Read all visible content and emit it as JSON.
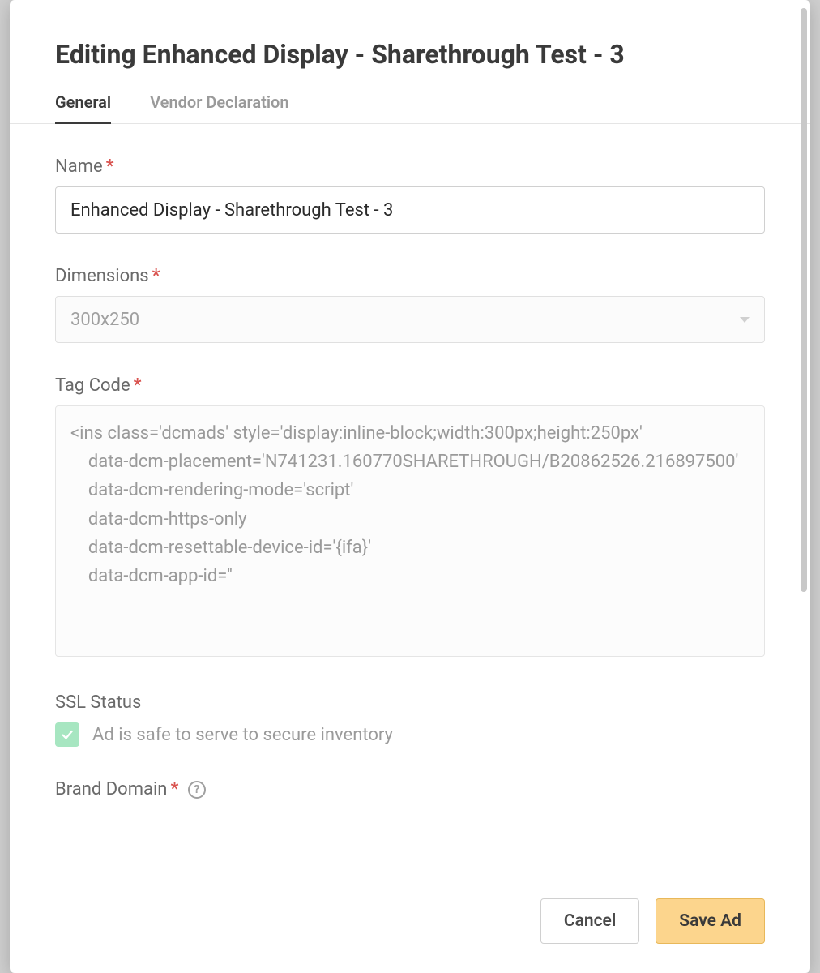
{
  "modal": {
    "title": "Editing Enhanced Display - Sharethrough Test - 3",
    "tabs": {
      "general": "General",
      "vendor": "Vendor Declaration"
    }
  },
  "form": {
    "name": {
      "label": "Name",
      "value": "Enhanced Display - Sharethrough Test - 3"
    },
    "dimensions": {
      "label": "Dimensions",
      "value": "300x250"
    },
    "tagCode": {
      "label": "Tag Code",
      "value": "<ins class='dcmads' style='display:inline-block;width:300px;height:250px'\n    data-dcm-placement='N741231.160770SHARETHROUGH/B20862526.216897500'\n    data-dcm-rendering-mode='script'\n    data-dcm-https-only\n    data-dcm-resettable-device-id='{ifa}'\n    data-dcm-app-id=''"
    },
    "sslStatus": {
      "label": "SSL Status",
      "text": "Ad is safe to serve to secure inventory"
    },
    "brandDomain": {
      "label": "Brand Domain"
    }
  },
  "footer": {
    "cancel": "Cancel",
    "save": "Save Ad"
  },
  "required_marker": "*",
  "help_marker": "?"
}
